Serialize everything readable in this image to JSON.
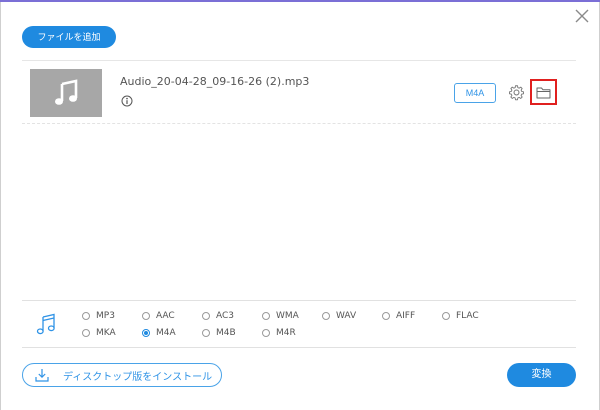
{
  "toolbar": {
    "add_file_label": "ファイルを追加"
  },
  "file": {
    "name": "Audio_20-04-28_09-16-26 (2).mp3",
    "output_format": "M4A",
    "thumbnail_icon": "music-note-icon"
  },
  "formats": {
    "row1": [
      "MP3",
      "AAC",
      "AC3",
      "WMA",
      "WAV",
      "AIFF",
      "FLAC"
    ],
    "row2": [
      "MKA",
      "M4A",
      "M4B",
      "M4R"
    ],
    "selected": "M4A"
  },
  "footer": {
    "install_label": "ディスクトップ版をインストール",
    "convert_label": "変換"
  },
  "colors": {
    "accent": "#1f8ae0",
    "highlight": "#e0201f",
    "thumbnail_bg": "#a7a7a7"
  }
}
